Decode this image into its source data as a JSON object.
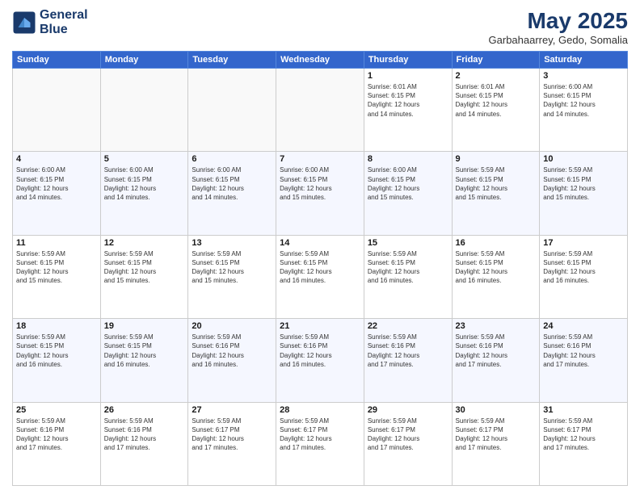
{
  "header": {
    "logo_line1": "General",
    "logo_line2": "Blue",
    "month_title": "May 2025",
    "subtitle": "Garbahaarrey, Gedo, Somalia"
  },
  "days_of_week": [
    "Sunday",
    "Monday",
    "Tuesday",
    "Wednesday",
    "Thursday",
    "Friday",
    "Saturday"
  ],
  "weeks": [
    [
      {
        "day": "",
        "info": ""
      },
      {
        "day": "",
        "info": ""
      },
      {
        "day": "",
        "info": ""
      },
      {
        "day": "",
        "info": ""
      },
      {
        "day": "1",
        "info": "Sunrise: 6:01 AM\nSunset: 6:15 PM\nDaylight: 12 hours\nand 14 minutes."
      },
      {
        "day": "2",
        "info": "Sunrise: 6:01 AM\nSunset: 6:15 PM\nDaylight: 12 hours\nand 14 minutes."
      },
      {
        "day": "3",
        "info": "Sunrise: 6:00 AM\nSunset: 6:15 PM\nDaylight: 12 hours\nand 14 minutes."
      }
    ],
    [
      {
        "day": "4",
        "info": "Sunrise: 6:00 AM\nSunset: 6:15 PM\nDaylight: 12 hours\nand 14 minutes."
      },
      {
        "day": "5",
        "info": "Sunrise: 6:00 AM\nSunset: 6:15 PM\nDaylight: 12 hours\nand 14 minutes."
      },
      {
        "day": "6",
        "info": "Sunrise: 6:00 AM\nSunset: 6:15 PM\nDaylight: 12 hours\nand 14 minutes."
      },
      {
        "day": "7",
        "info": "Sunrise: 6:00 AM\nSunset: 6:15 PM\nDaylight: 12 hours\nand 15 minutes."
      },
      {
        "day": "8",
        "info": "Sunrise: 6:00 AM\nSunset: 6:15 PM\nDaylight: 12 hours\nand 15 minutes."
      },
      {
        "day": "9",
        "info": "Sunrise: 5:59 AM\nSunset: 6:15 PM\nDaylight: 12 hours\nand 15 minutes."
      },
      {
        "day": "10",
        "info": "Sunrise: 5:59 AM\nSunset: 6:15 PM\nDaylight: 12 hours\nand 15 minutes."
      }
    ],
    [
      {
        "day": "11",
        "info": "Sunrise: 5:59 AM\nSunset: 6:15 PM\nDaylight: 12 hours\nand 15 minutes."
      },
      {
        "day": "12",
        "info": "Sunrise: 5:59 AM\nSunset: 6:15 PM\nDaylight: 12 hours\nand 15 minutes."
      },
      {
        "day": "13",
        "info": "Sunrise: 5:59 AM\nSunset: 6:15 PM\nDaylight: 12 hours\nand 15 minutes."
      },
      {
        "day": "14",
        "info": "Sunrise: 5:59 AM\nSunset: 6:15 PM\nDaylight: 12 hours\nand 16 minutes."
      },
      {
        "day": "15",
        "info": "Sunrise: 5:59 AM\nSunset: 6:15 PM\nDaylight: 12 hours\nand 16 minutes."
      },
      {
        "day": "16",
        "info": "Sunrise: 5:59 AM\nSunset: 6:15 PM\nDaylight: 12 hours\nand 16 minutes."
      },
      {
        "day": "17",
        "info": "Sunrise: 5:59 AM\nSunset: 6:15 PM\nDaylight: 12 hours\nand 16 minutes."
      }
    ],
    [
      {
        "day": "18",
        "info": "Sunrise: 5:59 AM\nSunset: 6:15 PM\nDaylight: 12 hours\nand 16 minutes."
      },
      {
        "day": "19",
        "info": "Sunrise: 5:59 AM\nSunset: 6:15 PM\nDaylight: 12 hours\nand 16 minutes."
      },
      {
        "day": "20",
        "info": "Sunrise: 5:59 AM\nSunset: 6:16 PM\nDaylight: 12 hours\nand 16 minutes."
      },
      {
        "day": "21",
        "info": "Sunrise: 5:59 AM\nSunset: 6:16 PM\nDaylight: 12 hours\nand 16 minutes."
      },
      {
        "day": "22",
        "info": "Sunrise: 5:59 AM\nSunset: 6:16 PM\nDaylight: 12 hours\nand 17 minutes."
      },
      {
        "day": "23",
        "info": "Sunrise: 5:59 AM\nSunset: 6:16 PM\nDaylight: 12 hours\nand 17 minutes."
      },
      {
        "day": "24",
        "info": "Sunrise: 5:59 AM\nSunset: 6:16 PM\nDaylight: 12 hours\nand 17 minutes."
      }
    ],
    [
      {
        "day": "25",
        "info": "Sunrise: 5:59 AM\nSunset: 6:16 PM\nDaylight: 12 hours\nand 17 minutes."
      },
      {
        "day": "26",
        "info": "Sunrise: 5:59 AM\nSunset: 6:16 PM\nDaylight: 12 hours\nand 17 minutes."
      },
      {
        "day": "27",
        "info": "Sunrise: 5:59 AM\nSunset: 6:17 PM\nDaylight: 12 hours\nand 17 minutes."
      },
      {
        "day": "28",
        "info": "Sunrise: 5:59 AM\nSunset: 6:17 PM\nDaylight: 12 hours\nand 17 minutes."
      },
      {
        "day": "29",
        "info": "Sunrise: 5:59 AM\nSunset: 6:17 PM\nDaylight: 12 hours\nand 17 minutes."
      },
      {
        "day": "30",
        "info": "Sunrise: 5:59 AM\nSunset: 6:17 PM\nDaylight: 12 hours\nand 17 minutes."
      },
      {
        "day": "31",
        "info": "Sunrise: 5:59 AM\nSunset: 6:17 PM\nDaylight: 12 hours\nand 17 minutes."
      }
    ]
  ]
}
